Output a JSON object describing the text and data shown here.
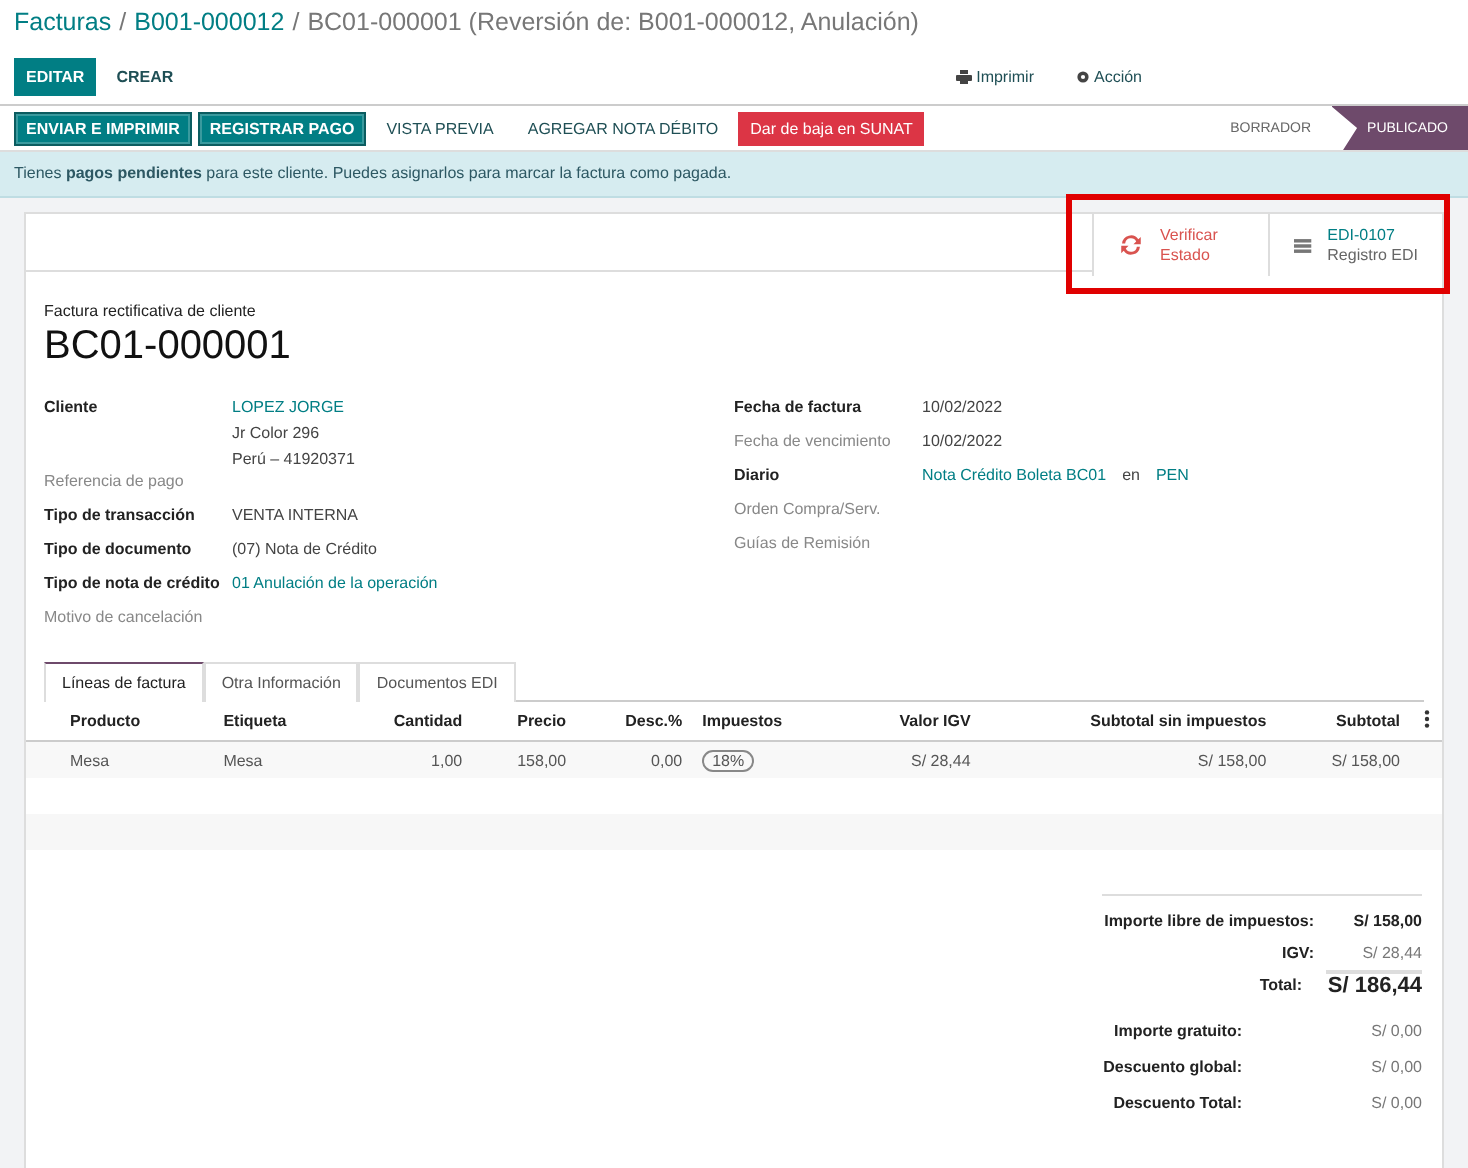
{
  "breadcrumb": [
    {
      "text": "Facturas",
      "kind": "link"
    },
    {
      "text": "/",
      "kind": "separator"
    },
    {
      "text": "B001-000012",
      "kind": "link"
    },
    {
      "text": "/",
      "kind": "separator"
    },
    {
      "text": "BC01-000001 (Reversión de: B001-000012, Anulación)",
      "kind": "current"
    }
  ],
  "control_panel": {
    "buttons": [
      {
        "label": "EDITAR",
        "kind": "primary"
      },
      {
        "label": "CREAR",
        "kind": "link"
      }
    ],
    "actions": [
      {
        "label": "Imprimir",
        "kind": "print"
      },
      {
        "label": "Acción",
        "kind": "gear"
      }
    ]
  },
  "header_buttons": [
    {
      "label": "ENVIAR E IMPRIMIR",
      "kind": "primary"
    },
    {
      "label": "REGISTRAR PAGO",
      "kind": "primary"
    },
    {
      "label": "VISTA PREVIA",
      "kind": "link"
    },
    {
      "label": "AGREGAR NOTA DÉBITO",
      "kind": "link"
    },
    {
      "label": "Dar de baja en SUNAT",
      "kind": "danger"
    }
  ],
  "statusbar": [
    {
      "label": "BORRADOR",
      "selected": false
    },
    {
      "label": "PUBLICADO",
      "selected": true
    }
  ],
  "alert": "Tienes **pagos pendientes** para este cliente. Puedes asignarlos para marcar la factura como pagada.",
  "smart_buttons": [
    {
      "kind": "refresh",
      "lines": [
        "Verificar",
        "Estado"
      ]
    },
    {
      "kind": "server",
      "lines": [
        "EDI-0107",
        "Registro EDI"
      ]
    }
  ],
  "document": {
    "type": "Factura rectificativa de cliente",
    "number": "BC01-000001"
  },
  "left_fields": [
    {
      "label": "Cliente",
      "strong": true,
      "values": [
        "LOPEZ JORGE",
        "Jr Color 296",
        "Perú – 41920371"
      ],
      "link": true
    },
    {
      "label": "Referencia de pago",
      "strong": false
    },
    {
      "label": "Tipo de transacción",
      "strong": true,
      "values": [
        "VENTA INTERNA"
      ],
      "link": false
    },
    {
      "label": "Tipo de documento",
      "strong": true,
      "values": [
        "(07) Nota de Crédito"
      ],
      "link": false
    },
    {
      "label": "Tipo de nota de crédito",
      "strong": true,
      "values": [
        "01 Anulación de la operación"
      ],
      "link": true
    },
    {
      "label": "Motivo de cancelación",
      "strong": false
    }
  ],
  "right_fields": [
    {
      "label": "Fecha de factura",
      "strong": true,
      "values": [
        "10/02/2022"
      ]
    },
    {
      "label": "Fecha de vencimiento",
      "strong": false,
      "values": [
        "10/02/2022"
      ]
    },
    {
      "label": "Diario",
      "strong": true,
      "journal": "Nota Crédito Boleta BC01",
      "joiner": "en",
      "currency": "PEN"
    },
    {
      "label": "Orden Compra/Serv.",
      "strong": false
    },
    {
      "label": "Guías de Remisión",
      "strong": false
    }
  ],
  "tabs": [
    {
      "label": "Líneas de factura",
      "selected": true
    },
    {
      "label": "Otra Información",
      "selected": false
    },
    {
      "label": "Documentos EDI",
      "selected": false
    }
  ],
  "table": {
    "columns": [
      "Producto",
      "Etiqueta",
      "Cantidad",
      "Precio",
      "Desc.%",
      "Impuestos",
      "Valor IGV",
      "Subtotal sin impuestos",
      "Subtotal"
    ],
    "rows": [
      {
        "cells": [
          "Mesa",
          "Mesa",
          "1,00",
          "158,00",
          "0,00",
          "18%",
          "S/ 28,44",
          "S/ 158,00",
          "S/ 158,00"
        ]
      }
    ]
  },
  "totals": [
    {
      "label": "Importe libre de impuestos:",
      "value": "S/ 158,00",
      "kind": "strong"
    },
    {
      "label": "IGV:",
      "value": "S/ 28,44",
      "kind": "normal"
    },
    {
      "label": "Total:",
      "value": "S/ 186,44",
      "kind": "total"
    }
  ],
  "extra_totals": [
    {
      "label": "Importe gratuito:",
      "value": "S/ 0,00"
    },
    {
      "label": "Descuento global:",
      "value": "S/ 0,00"
    },
    {
      "label": "Descuento Total:",
      "value": "S/ 0,00"
    }
  ]
}
